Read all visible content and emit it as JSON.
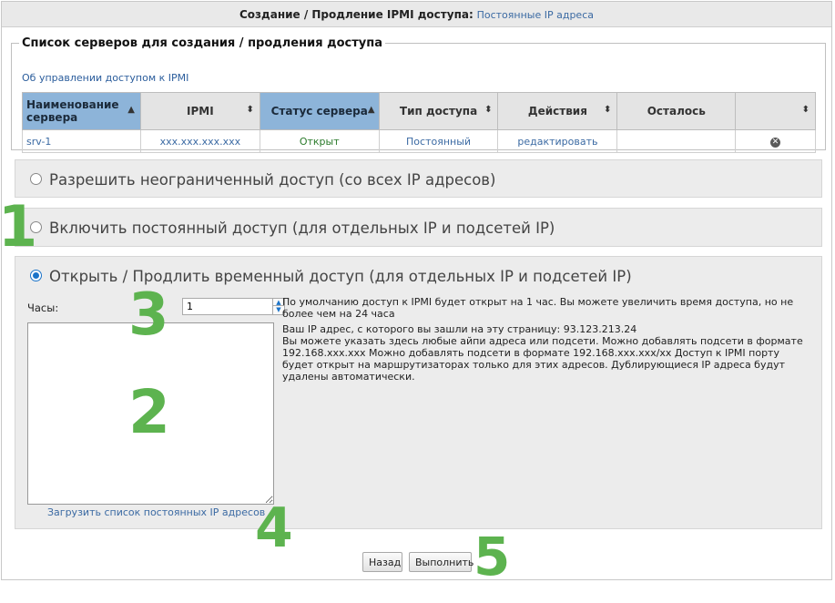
{
  "title": {
    "main": "Создание / Продление IPMI доступа:",
    "sub": "Постоянные IP адреса"
  },
  "servers_section": {
    "legend": "Список серверов для создания / продления доступа",
    "mgmt_link": "Об управлении доступом к IPMI",
    "columns": [
      "Наименование сервера",
      "IPMI",
      "Статус сервера",
      "Тип доступа",
      "Действия",
      "Осталось",
      ""
    ],
    "rows": [
      {
        "name": "srv-1",
        "ipmi": "xxx.xxx.xxx.xxx",
        "status": "Открыт",
        "access_type": "Постоянный",
        "action": "редактировать",
        "remaining": ""
      }
    ],
    "colors": {
      "sorted_header": "#8db4d9",
      "status_open": "#2a7a2a",
      "link": "#3b6aa3"
    }
  },
  "options": {
    "unlimited": "Разрешить неограниченный доступ (со всех IP адресов)",
    "permanent": "Включить постоянный доступ (для отдельных IP и подсетей IP)",
    "temporary": "Открыть / Продлить временный доступ (для отдельных IP и подсетей IP)",
    "selected": "temporary"
  },
  "temporary_form": {
    "hours_label": "Часы:",
    "hours_value": "1",
    "ip_list_value": "",
    "info_line1": "По умолчанию доступ к IPMI будет открыт на 1 час. Вы можете увеличить время доступа, но не более чем на 24 часа",
    "info_line2": "Ваш IP адрес, с которого вы зашли на эту страницу: 93.123.213.24",
    "info_line3": "Вы можете указать здесь любые айпи адреса или подсети. Можно добавлять подсети в формате 192.168.xxx.xxx Можно добавлять подсети в формате 192.168.xxx.xxx/xx Доступ к IPMI порту будет открыт на маршрутизаторах только для этих адресов. Дублирующиеся IP адреса будут удалены автоматически.",
    "load_link": "Загрузить список постоянных IP адресов"
  },
  "buttons": {
    "back": "Назад",
    "submit": "Выполнить"
  },
  "annotations": [
    "1",
    "2",
    "3",
    "4",
    "5"
  ],
  "icons": {
    "delete": "close-circle-icon",
    "sort": "sort-arrows-icon",
    "spinner": "spinner-arrows-icon"
  }
}
